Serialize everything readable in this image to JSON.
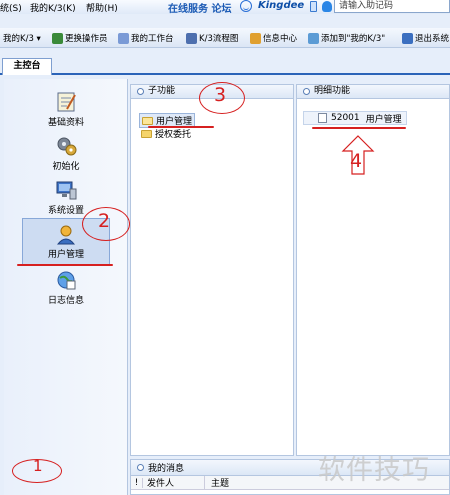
{
  "menu": {
    "items": [
      "统(S)",
      "我的K/3(K)",
      "帮助(H)"
    ],
    "online_service": "在线服务 论坛",
    "brand": "Kingdee",
    "search_placeholder": "请输入助记码"
  },
  "toolbar": {
    "my_k3": "我的K/3 ▾",
    "change_operator": "更换操作员",
    "my_workbench": "我的工作台",
    "k3_flowchart": "K/3流程图",
    "info_center": "信息中心",
    "add_to_my_k3": "添加到\"我的K/3\"",
    "exit_system": "退出系统"
  },
  "tabs": {
    "main_console": "主控台"
  },
  "sidebar": {
    "items": [
      {
        "label": "基础资料",
        "icon": "document-pen-icon"
      },
      {
        "label": "初始化",
        "icon": "gears-icon"
      },
      {
        "label": "系统设置",
        "icon": "monitor-settings-icon"
      },
      {
        "label": "用户管理",
        "icon": "user-icon",
        "selected": true
      },
      {
        "label": "日志信息",
        "icon": "globe-log-icon"
      }
    ]
  },
  "subfunctions": {
    "title": "子功能",
    "items": [
      "用户管理",
      "授权委托"
    ]
  },
  "details": {
    "title": "明细功能",
    "items": [
      {
        "code": "52001",
        "name": "用户管理"
      }
    ]
  },
  "messages": {
    "title": "我的消息",
    "columns": [
      "!",
      "发件人",
      "主题"
    ]
  },
  "annotations": {
    "n1": "1",
    "n2": "2",
    "n3": "3",
    "n4": "4",
    "annotation_color": "#d62020"
  },
  "watermark": "软件技巧",
  "colors": {
    "accent": "#2b63b8",
    "panel_bg": "#e6eefa"
  }
}
